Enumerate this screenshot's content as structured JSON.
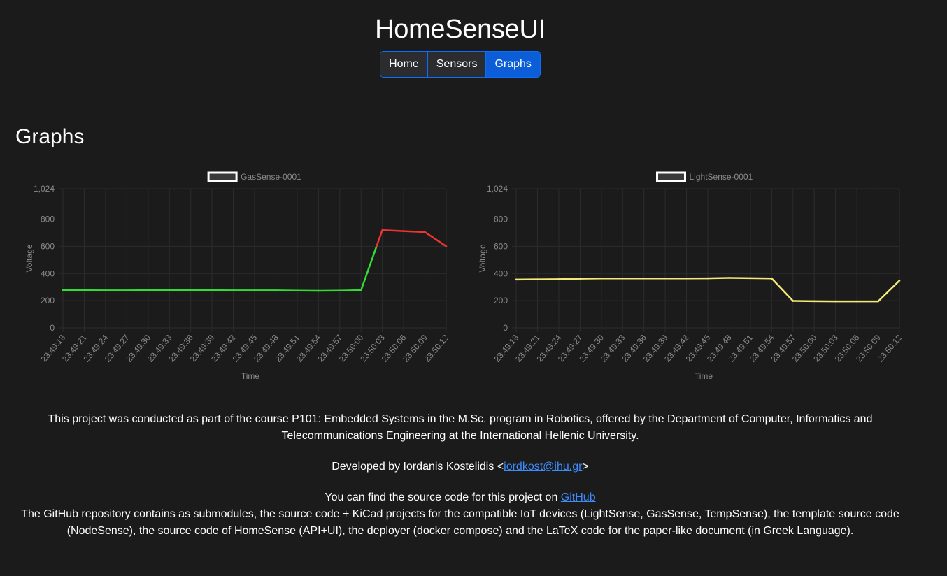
{
  "app": {
    "title": "HomeSenseUI"
  },
  "nav": {
    "items": [
      {
        "label": "Home",
        "active": false
      },
      {
        "label": "Sensors",
        "active": false
      },
      {
        "label": "Graphs",
        "active": true
      }
    ]
  },
  "main": {
    "section_title": "Graphs"
  },
  "chart_data": [
    {
      "type": "line",
      "title": "",
      "legend": {
        "label": "GasSense-0001",
        "placement": "top"
      },
      "xlabel": "Time",
      "ylabel": "Voltage",
      "ylim": [
        0,
        1024
      ],
      "yticks": [
        0,
        200,
        400,
        600,
        800,
        1024
      ],
      "ytick_labels": [
        "0",
        "200",
        "400",
        "600",
        "800",
        "1,024"
      ],
      "grid": true,
      "threshold": 600,
      "color_below": "#33dd33",
      "color_above": "#ee3333",
      "x": [
        "23:49:18",
        "23:49:21",
        "23:49:24",
        "23:49:27",
        "23:49:30",
        "23:49:33",
        "23:49:36",
        "23:49:39",
        "23:49:42",
        "23:49:45",
        "23:49:48",
        "23:49:51",
        "23:49:54",
        "23:49:57",
        "23:50:00",
        "23:50:03",
        "23:50:06",
        "23:50:09",
        "23:50:12"
      ],
      "values": [
        278,
        277,
        276,
        276,
        277,
        278,
        278,
        277,
        276,
        276,
        276,
        274,
        273,
        274,
        277,
        720,
        712,
        705,
        600
      ]
    },
    {
      "type": "line",
      "title": "",
      "legend": {
        "label": "LightSense-0001",
        "placement": "top"
      },
      "xlabel": "Time",
      "ylabel": "Voltage",
      "ylim": [
        0,
        1024
      ],
      "yticks": [
        0,
        200,
        400,
        600,
        800,
        1024
      ],
      "ytick_labels": [
        "0",
        "200",
        "400",
        "600",
        "800",
        "1,024"
      ],
      "grid": true,
      "color": "#f5e97a",
      "x": [
        "23:49:18",
        "23:49:21",
        "23:49:24",
        "23:49:27",
        "23:49:30",
        "23:49:33",
        "23:49:36",
        "23:49:39",
        "23:49:42",
        "23:49:45",
        "23:49:48",
        "23:49:51",
        "23:49:54",
        "23:49:57",
        "23:50:00",
        "23:50:03",
        "23:50:06",
        "23:50:09",
        "23:50:12"
      ],
      "values": [
        356,
        357,
        358,
        362,
        364,
        364,
        364,
        364,
        364,
        365,
        368,
        366,
        364,
        198,
        196,
        195,
        195,
        195,
        348
      ]
    }
  ],
  "footer": {
    "about": "This project was conducted as part of the course P101: Embedded Systems in the M.Sc. program in Robotics, offered by the Department of Computer, Informatics and Telecommunications Engineering at the International Hellenic University.",
    "developer_prefix": "Developed by Iordanis Kostelidis <",
    "developer_email": "iordkost@ihu.gr",
    "developer_suffix": ">",
    "source_prefix": "You can find the source code for this project on ",
    "source_link": "GitHub",
    "repo_description": "The GitHub repository contains as submodules, the source code + KiCad projects for the compatible IoT devices (LightSense, GasSense, TempSense), the template source code (NodeSense), the source code of HomeSense (API+UI), the deployer (docker compose) and the LaTeX code for the paper-like document (in Greek Language)."
  }
}
